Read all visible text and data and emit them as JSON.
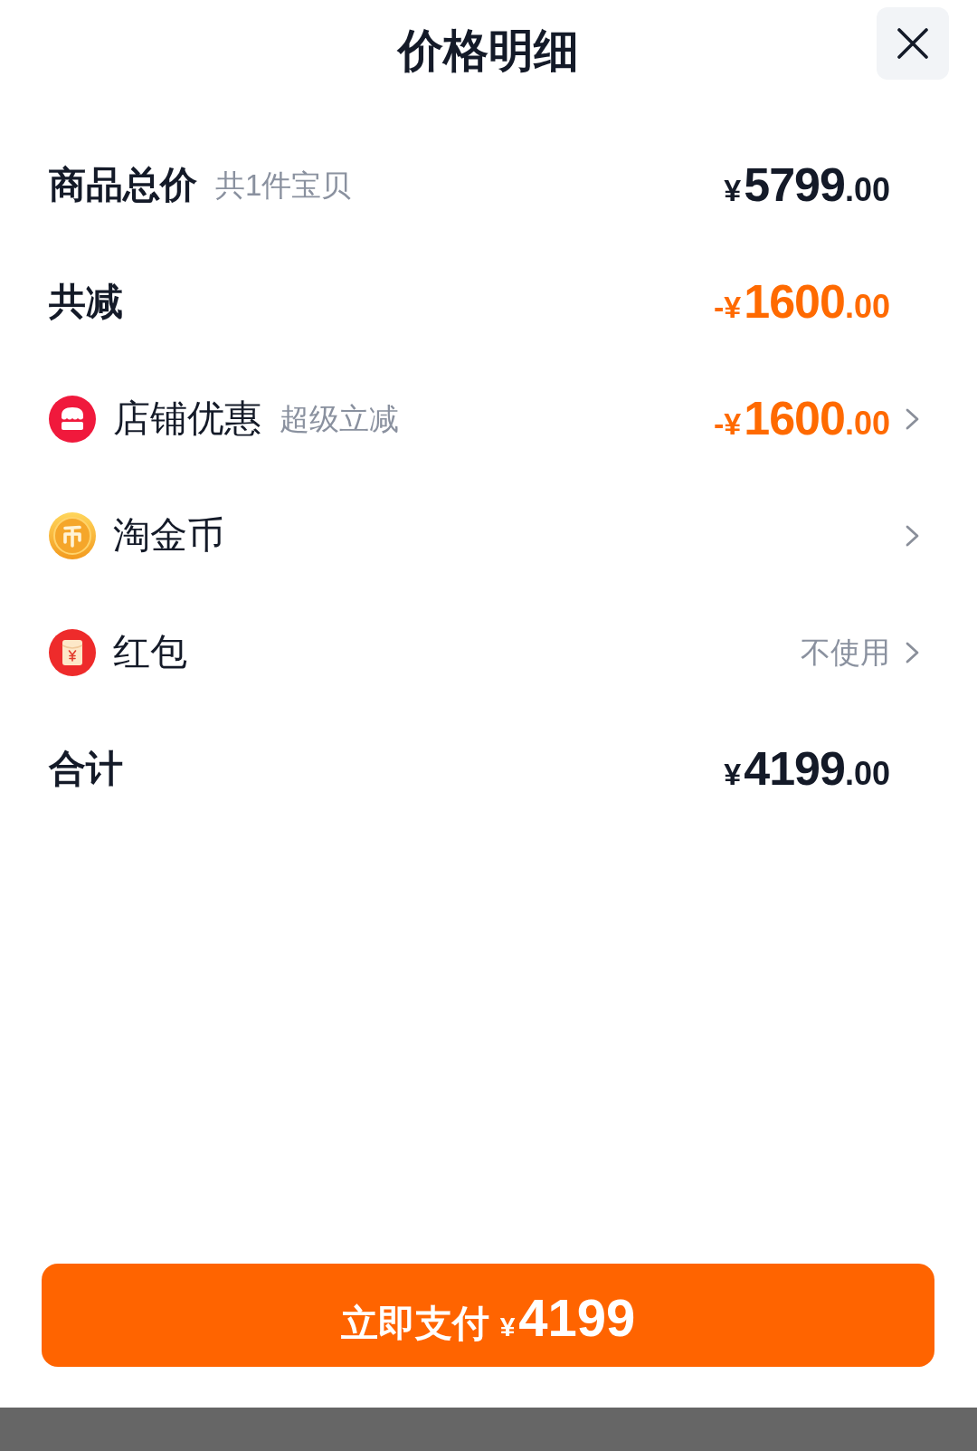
{
  "header": {
    "title": "价格明细"
  },
  "rows": [
    {
      "kind": "summary",
      "label": "商品总价",
      "note": "共1件宝贝",
      "amount": {
        "symbol": "¥",
        "whole": "5799",
        "fraction": ".00",
        "discount": false
      }
    },
    {
      "kind": "summary",
      "label": "共减",
      "amount": {
        "symbol": "-¥",
        "whole": "1600",
        "fraction": ".00",
        "discount": true
      }
    },
    {
      "kind": "store",
      "label": "店铺优惠",
      "note": "超级立减",
      "amount": {
        "symbol": "-¥",
        "whole": "1600",
        "fraction": ".00",
        "discount": true
      }
    },
    {
      "kind": "coin",
      "label": "淘金币"
    },
    {
      "kind": "envelope",
      "label": "红包",
      "value": "不使用"
    },
    {
      "kind": "summary",
      "label": "合计",
      "amount": {
        "symbol": "¥",
        "whole": "4199",
        "fraction": ".00",
        "discount": false
      }
    }
  ],
  "pay_button": {
    "label": "立即支付",
    "symbol": "¥",
    "amount": "4199"
  }
}
